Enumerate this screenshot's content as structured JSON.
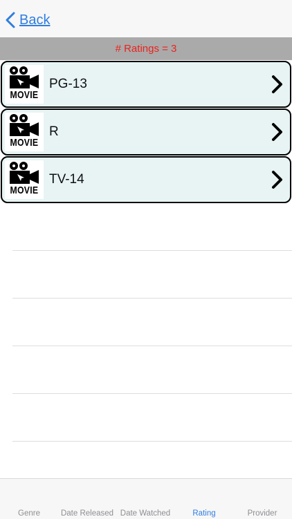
{
  "nav": {
    "back_label": "Back"
  },
  "count_label": "# Ratings = 3",
  "ratings": [
    {
      "label": "PG-13",
      "thumb_text": "MOVIE"
    },
    {
      "label": "R",
      "thumb_text": "MOVIE"
    },
    {
      "label": "TV-14",
      "thumb_text": "MOVIE"
    }
  ],
  "tabs": [
    {
      "label": "Genre"
    },
    {
      "label": "Date Released"
    },
    {
      "label": "Date Watched"
    },
    {
      "label": "Rating"
    },
    {
      "label": "Provider"
    }
  ],
  "active_tab": "Rating",
  "colors": {
    "accent": "#2f7de1",
    "count_text": "#e8231f",
    "row_bg": "#e8f4f4",
    "count_bar": "#aaaaaa"
  },
  "icons": {
    "back": "chevron-left-icon",
    "row_disclosure": "chevron-right-icon",
    "thumbnail": "movie-camera-icon"
  }
}
